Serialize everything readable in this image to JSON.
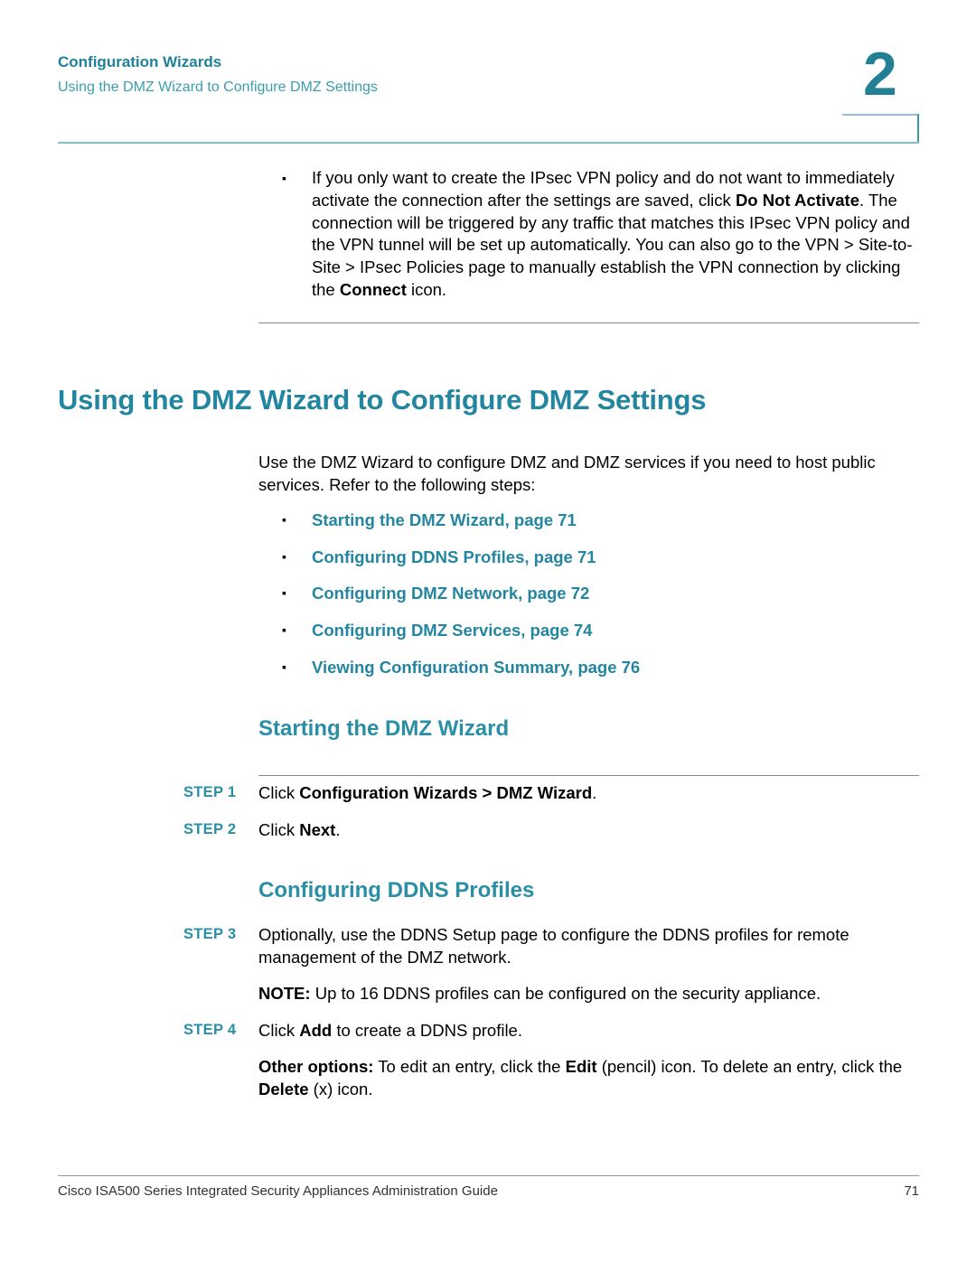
{
  "header": {
    "chapter_title": "Configuration Wizards",
    "section_title": "Using the DMZ Wizard to Configure DMZ Settings",
    "chapter_number": "2"
  },
  "prior_bullet": {
    "t1": "If you only want to create the IPsec VPN policy and do not want to immediately activate the connection after the settings are saved, click ",
    "b1": "Do Not Activate",
    "t2": ". The connection will be triggered by any traffic that matches this IPsec VPN policy and the VPN tunnel will be set up automatically. You can also go to the VPN > Site-to-Site > IPsec Policies page to manually establish the VPN connection by clicking the ",
    "b2": "Connect",
    "t3": " icon."
  },
  "main": {
    "title": "Using the DMZ Wizard to Configure DMZ Settings",
    "intro": "Use the DMZ Wizard to configure DMZ and DMZ services if you need to host public services. Refer to the following steps:",
    "bullet_glyph": "▪",
    "toc": [
      {
        "label": "Starting the DMZ Wizard, page 71"
      },
      {
        "label": "Configuring DDNS Profiles, page 71"
      },
      {
        "label": "Configuring DMZ Network, page 72"
      },
      {
        "label": "Configuring DMZ Services, page 74"
      },
      {
        "label": "Viewing Configuration Summary, page 76"
      }
    ]
  },
  "section1": {
    "title": "Starting the DMZ Wizard",
    "steps": [
      {
        "label": "STEP 1",
        "t1": "Click ",
        "b1": "Configuration Wizards > DMZ Wizard",
        "t2": "."
      },
      {
        "label": "STEP 2",
        "t1": "Click ",
        "b1": "Next",
        "t2": "."
      }
    ]
  },
  "section2": {
    "title": "Configuring DDNS Profiles",
    "step3": {
      "label": "STEP 3",
      "text": "Optionally, use the DDNS Setup page to configure the DDNS profiles for remote management of the DMZ network."
    },
    "note": {
      "b": "NOTE:",
      "t": " Up to 16 DDNS profiles can be configured on the security appliance."
    },
    "step4": {
      "label": "STEP 4",
      "t1": "Click ",
      "b1": "Add",
      "t2": " to create a DDNS profile."
    },
    "other": {
      "b1": "Other options:",
      "t1": " To edit an entry, click the ",
      "b2": "Edit",
      "t2": " (pencil) icon. To delete an entry, click the ",
      "b3": "Delete",
      "t3": " (x) icon."
    }
  },
  "footer": {
    "guide_title": "Cisco ISA500 Series Integrated Security Appliances Administration Guide",
    "page_number": "71"
  },
  "colors": {
    "accent": "#2386a0",
    "header_rule": "#7fc3c9"
  }
}
